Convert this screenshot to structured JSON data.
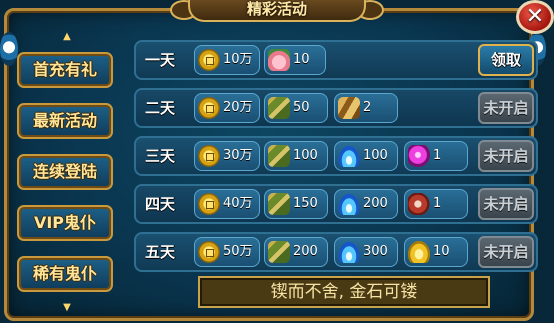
{
  "window": {
    "title": "精彩活动",
    "close_label": "✕"
  },
  "tabs": [
    {
      "label": "首充有礼"
    },
    {
      "label": "最新活动"
    },
    {
      "label": "连续登陆"
    },
    {
      "label": "VIP鬼仆"
    },
    {
      "label": "稀有鬼仆"
    }
  ],
  "rows": [
    {
      "day": "一天",
      "button": "领取",
      "button_state": "active",
      "rewards": [
        {
          "icon": "coin-icon",
          "qty": "10万"
        },
        {
          "icon": "peach-icon",
          "qty": "10"
        }
      ]
    },
    {
      "day": "二天",
      "button": "未开启",
      "button_state": "inactive",
      "rewards": [
        {
          "icon": "coin-icon",
          "qty": "20万"
        },
        {
          "icon": "herb-icon",
          "qty": "50"
        },
        {
          "icon": "scroll-icon",
          "qty": "2"
        }
      ]
    },
    {
      "day": "三天",
      "button": "未开启",
      "button_state": "inactive",
      "rewards": [
        {
          "icon": "coin-icon",
          "qty": "30万"
        },
        {
          "icon": "herb-icon",
          "qty": "100"
        },
        {
          "icon": "blue-flame-icon",
          "qty": "100"
        },
        {
          "icon": "pink-gem-icon",
          "qty": "1"
        }
      ]
    },
    {
      "day": "四天",
      "button": "未开启",
      "button_state": "inactive",
      "rewards": [
        {
          "icon": "coin-icon",
          "qty": "40万"
        },
        {
          "icon": "herb-icon",
          "qty": "150"
        },
        {
          "icon": "blue-flame-icon",
          "qty": "200"
        },
        {
          "icon": "meat-icon",
          "qty": "1"
        }
      ]
    },
    {
      "day": "五天",
      "button": "未开启",
      "button_state": "inactive",
      "rewards": [
        {
          "icon": "coin-icon",
          "qty": "50万"
        },
        {
          "icon": "herb-icon",
          "qty": "200"
        },
        {
          "icon": "blue-flame-icon",
          "qty": "300"
        },
        {
          "icon": "gold-ingot-icon",
          "qty": "10"
        }
      ]
    }
  ],
  "motto": "锲而不舍, 金石可镂",
  "colors": {
    "accent_gold": "#c89a3d",
    "panel_blue": "#0a3650",
    "button_active": "#2a7ca8",
    "button_inactive": "#5b6770"
  }
}
